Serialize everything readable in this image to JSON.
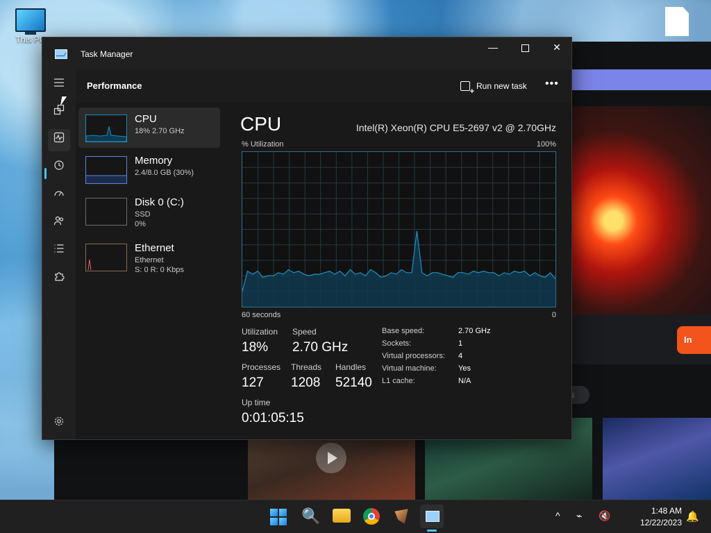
{
  "desktop": {
    "this_pc_label": "This PC"
  },
  "browser_background": {
    "cta_label": "In",
    "pill_label": "s"
  },
  "window": {
    "title": "Task Manager",
    "min_glyph": "—",
    "close_glyph": "✕"
  },
  "header": {
    "title": "Performance",
    "run_new_task": "Run new task",
    "more": "•••"
  },
  "sidebar": {
    "items": [
      {
        "title": "CPU",
        "sub": "18%  2.70 GHz",
        "sub2": ""
      },
      {
        "title": "Memory",
        "sub": "2.4/8.0 GB (30%)",
        "sub2": ""
      },
      {
        "title": "Disk 0 (C:)",
        "sub": "SSD",
        "sub2": "0%"
      },
      {
        "title": "Ethernet",
        "sub": "Ethernet",
        "sub2": "S: 0  R: 0 Kbps"
      }
    ]
  },
  "cpu": {
    "heading": "CPU",
    "model": "Intel(R) Xeon(R) CPU E5-2697 v2 @ 2.70GHz",
    "graph_label": "% Utilization",
    "graph_max": "100%",
    "graph_time": "60 seconds",
    "graph_zero": "0",
    "utilization_series": [
      10,
      23,
      21,
      23,
      19,
      20,
      20,
      22,
      21,
      24,
      22,
      23,
      21,
      20,
      21,
      21,
      22,
      23,
      21,
      23,
      20,
      24,
      21,
      22,
      20,
      24,
      22,
      19,
      20,
      22,
      21,
      24,
      22,
      22,
      49,
      22,
      20,
      22,
      22,
      21,
      20,
      19,
      22,
      22,
      21,
      23,
      22,
      23,
      22,
      22,
      20,
      22,
      21,
      23,
      22,
      23,
      20,
      22,
      20,
      19,
      22,
      18
    ],
    "stats": {
      "utilization_label": "Utilization",
      "utilization_value": "18%",
      "speed_label": "Speed",
      "speed_value": "2.70 GHz",
      "processes_label": "Processes",
      "processes_value": "127",
      "threads_label": "Threads",
      "threads_value": "1208",
      "handles_label": "Handles",
      "handles_value": "52140",
      "uptime_label": "Up time",
      "uptime_value": "0:01:05:15"
    },
    "specs": [
      {
        "label": "Base speed:",
        "value": "2.70 GHz"
      },
      {
        "label": "Sockets:",
        "value": "1"
      },
      {
        "label": "Virtual processors:",
        "value": "4"
      },
      {
        "label": "Virtual machine:",
        "value": "Yes"
      },
      {
        "label": "L1 cache:",
        "value": "N/A"
      }
    ]
  },
  "taskbar": {
    "search_glyph": "🔍",
    "tray_up": "^",
    "tray_net": "⌁",
    "tray_vol": "🔇",
    "time": "1:48 AM",
    "date": "12/22/2023",
    "bell": "🔔"
  },
  "colors": {
    "accent": "#4cc2ff",
    "cpu_graph_line": "#1f8ab8",
    "cpu_graph_fill": "#0f3a4f"
  }
}
